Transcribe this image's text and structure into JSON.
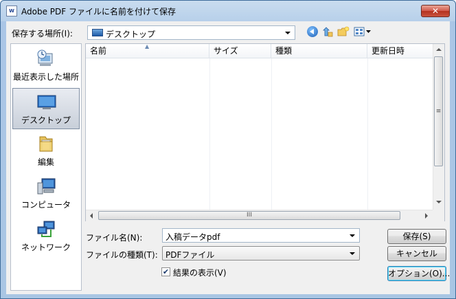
{
  "window": {
    "title": "Adobe PDF ファイルに名前を付けて保存",
    "app_icon_label": "W",
    "close_symbol": "✕"
  },
  "location": {
    "label": "保存する場所(I):",
    "value": "デスクトップ"
  },
  "places": [
    {
      "label": "最近表示した場所",
      "icon": "recent-places-icon",
      "selected": false
    },
    {
      "label": "デスクトップ",
      "icon": "desktop-icon",
      "selected": true
    },
    {
      "label": "編集",
      "icon": "folder-icon",
      "selected": false
    },
    {
      "label": "コンピュータ",
      "icon": "computer-icon",
      "selected": false
    },
    {
      "label": "ネットワーク",
      "icon": "network-icon",
      "selected": false
    }
  ],
  "columns": [
    "名前",
    "サイズ",
    "種類",
    "更新日時"
  ],
  "filename": {
    "label": "ファイル名(N):",
    "value": "入稿データpdf"
  },
  "filetype": {
    "label": "ファイルの種類(T):",
    "value": "PDFファイル"
  },
  "show_results": {
    "label": "結果の表示(V)",
    "checked": true
  },
  "buttons": {
    "save": "保存(S)",
    "cancel": "キャンセル",
    "options": "オプション(O)..."
  },
  "scroll_grip": "≡",
  "hscroll_grip": "III",
  "colors": {
    "title_bar": "#b7d0ea",
    "close_red": "#c9533d",
    "dialog_bg": "#f0f0f0"
  }
}
